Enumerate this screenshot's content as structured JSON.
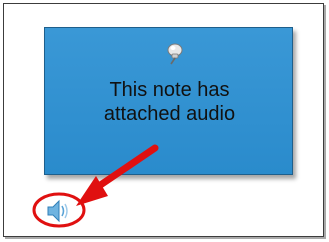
{
  "note": {
    "text": "This note has\nattached audio",
    "color": "#2e8fd0",
    "border_color": "#1e5f8c"
  },
  "icons": {
    "pin": "pushpin-icon",
    "speaker": "speaker-icon",
    "highlight": "highlight-ellipse",
    "callout": "red-arrow"
  },
  "colors": {
    "accent_red": "#e01010",
    "speaker_blue": "#6fb3e0"
  }
}
